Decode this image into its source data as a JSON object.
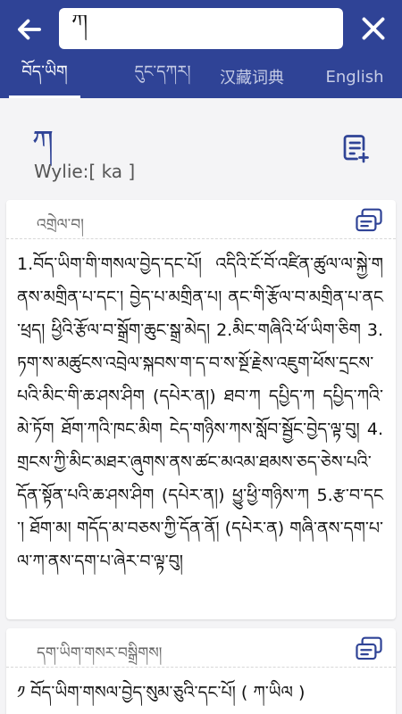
{
  "header": {
    "back_icon": "arrow-left-icon",
    "search_value": "ཀ",
    "close_icon": "close-icon"
  },
  "tabs": [
    {
      "label": "བོད་ཡིག",
      "active": true
    },
    {
      "label": "དུང་དཀར།",
      "active": false
    },
    {
      "label": "汉藏词典",
      "active": false
    },
    {
      "label": "English",
      "active": false
    }
  ],
  "entry": {
    "headword": "ཀ",
    "wylie": "Wylie:[ ka ]",
    "add_note_icon": "note-add-icon"
  },
  "sections": [
    {
      "title": "འགྲེལ་བ།",
      "copy_icon": "copy-icon",
      "text": "1.བོད་ཡིག་གི་གསལ་བྱེད་དང་པོ། འདིའི་ངོ་བོ་འཛིན་ཚུལ་ལ་སྐྱེ་གནས་མགྲིན་པ་དང་། བྱེད་པ་མགྲིན་པ། ནང་གི་རྩོལ་བ་མགྲིན་པ་ནང་ཕྲད། ཕྱིའི་རྩོལ་བ་སྒྲོག་ཆུང་སྒྲ་མེད། 2.མིང་གཞིའི་ཕོ་ཡིག་ཅིག 3.ཏག་ས་མཚུངས་འབྲེལ་སྐབས་ག་ད་བ་ས་སྔོ་རྗེས་འཇུག་ཕོས་དྲངས་པའི་མིང་གི་ཆ་ཤས་ཤིག (དཔེར་ན།) ཐབ་ཀ དཔྱིད་ཀ དཔྱིད་ཀའི་མེ་ཏོག ཐོག་ཀའི་ཁང་མིག ངེད་གཉིས་ཀས་སློབ་སྦྱོང་བྱེད་ལྟ་བུ། 4.གྲངས་ཀྱི་མིང་མཐར་ཞུགས་ནས་ཚང་མའམ་ཐམས་ཅད་ཅེས་པའི་དོན་སྟོན་པའི་ཆ་ཤས་ཤིག (དཔེར་ན།) ཕྱུ་ཕྱི་གཉིས་ཀ 5.རྩ་བ་དང་། ཐོག་མ། གདོད་མ་བཅས་ཀྱི་དོན་ནོ། (དཔེར་ན) གཞི་ནས་དག་པ་ལ་ཀ་ནས་དག་པ་ཞེར་བ་ལྟ་བུ།"
    },
    {
      "title": "དག་ཡིག་གསར་བསྒྲིགས།",
      "copy_icon": "copy-icon",
      "text": "༡ བོད་ཡིག་གསལ་བྱེད་སུམ་ཅུའི་དང་པོ། ( ཀ་ཡིལ )"
    }
  ]
}
